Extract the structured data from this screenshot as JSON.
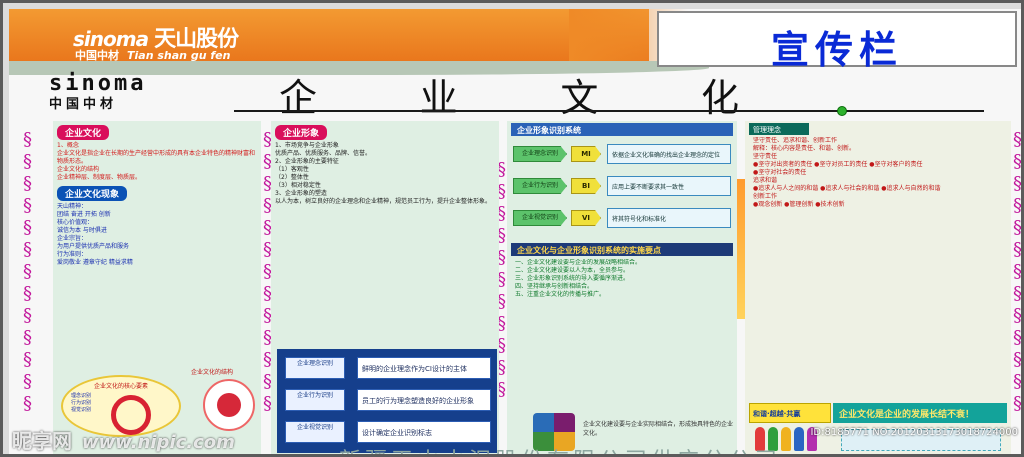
{
  "header": {
    "logo_latin": "sinoma",
    "logo_cn": "天山股份",
    "logo_sub_cn": "中国中材",
    "logo_sub_en": "Tian shan gu fen",
    "board_title": "宣传栏"
  },
  "subheader": {
    "brand_latin": "sinoma",
    "brand_cn": "中国中材",
    "page_title_chars": [
      "企",
      "业",
      "文",
      "化"
    ]
  },
  "panel1": {
    "head1": "企业文化",
    "body1": "1、概念\n企业文化是指企业在长期的生产经营中形成的具有本企业特色的精神财富和物质形态。\n企业文化的结构\n企业精神层、制度层、物质层。",
    "head2": "企业文化现象",
    "body2": "天山精神：\n团结 奋进 开拓 创新\n核心价值观：\n诚信为本 与时俱进\n企业宗旨：\n为用户提供优质产品和服务\n行为准则：\n爱岗敬业 遵章守纪 精益求精",
    "oval_title": "企业文化的核心要素",
    "oval_items": [
      "理念识别",
      "行为识别",
      "视觉识别"
    ],
    "circle_title": "企业文化的结构"
  },
  "panel2": {
    "head": "企业形象",
    "body": "1、市场竞争与企业形象\n优质产品、优质服务、品牌、信誉。\n2、企业形象的主要特征\n（1）客观性\n（2）整体性\n（3）相对稳定性\n3、企业形象的塑造\n以人为本，树立良好的企业理念和企业精神，规范员工行为，提升企业整体形象。",
    "flow": [
      {
        "left": "企业理念识别",
        "right": "鲜明的企业理念作为CI设计的主体"
      },
      {
        "left": "企业行为识别",
        "right": "员工的行为理念塑造良好的企业形象"
      },
      {
        "left": "企业视觉识别",
        "right": "设计确定企业识别标志"
      }
    ]
  },
  "panel3": {
    "head": "企业形象识别系统",
    "rows": [
      {
        "left": "企业理念识别",
        "tag": "MI",
        "right": "依据企业文化准确的找出企业理念的定位"
      },
      {
        "left": "企业行为识别",
        "tag": "BI",
        "right": "应用上要不断要求其一致性"
      },
      {
        "left": "企业视觉识别",
        "tag": "VI",
        "right": "将其符号化和标准化"
      }
    ],
    "head2": "企业文化与企业形象识别系统的实施要点",
    "body2": "一、企业文化建设要与企业的发展战略相结合。\n二、企业文化建设要以人为本，全员参与。\n三、企业形象识别系统的导入要循序渐进。\n四、坚持继承与创新相结合。\n五、注重企业文化的传播与推广。",
    "bottom": "企业文化建设要与企业实际相结合，形成独具特色的企业文化。"
  },
  "panel4": {
    "head": "管理理念",
    "body": "坚守责任、追求和谐、创新工作\n解释：核心内容是责任、和谐、创新。\n坚守责任\n●坚守对出资者的责任 ●坚守对员工的责任 ●坚守对客户的责任\n●坚守对社会的责任\n追求和谐\n●追求人与人之间的和谐 ●追求人与社会的和谐 ●追求人与自然的和谐\n创新工作\n●观念创新 ●管理创新 ●技术创新",
    "banner_left": "和谐·超越·共赢",
    "banner_right": "企业文化是企业的发展长结不衰！"
  },
  "footer": {
    "company": "新疆天山水泥股份有限公司供应分公司"
  },
  "watermark": {
    "site": "昵享网",
    "url": "www.nipic.com",
    "id_line": "ID:8185771 NO:20120313173018724000"
  }
}
